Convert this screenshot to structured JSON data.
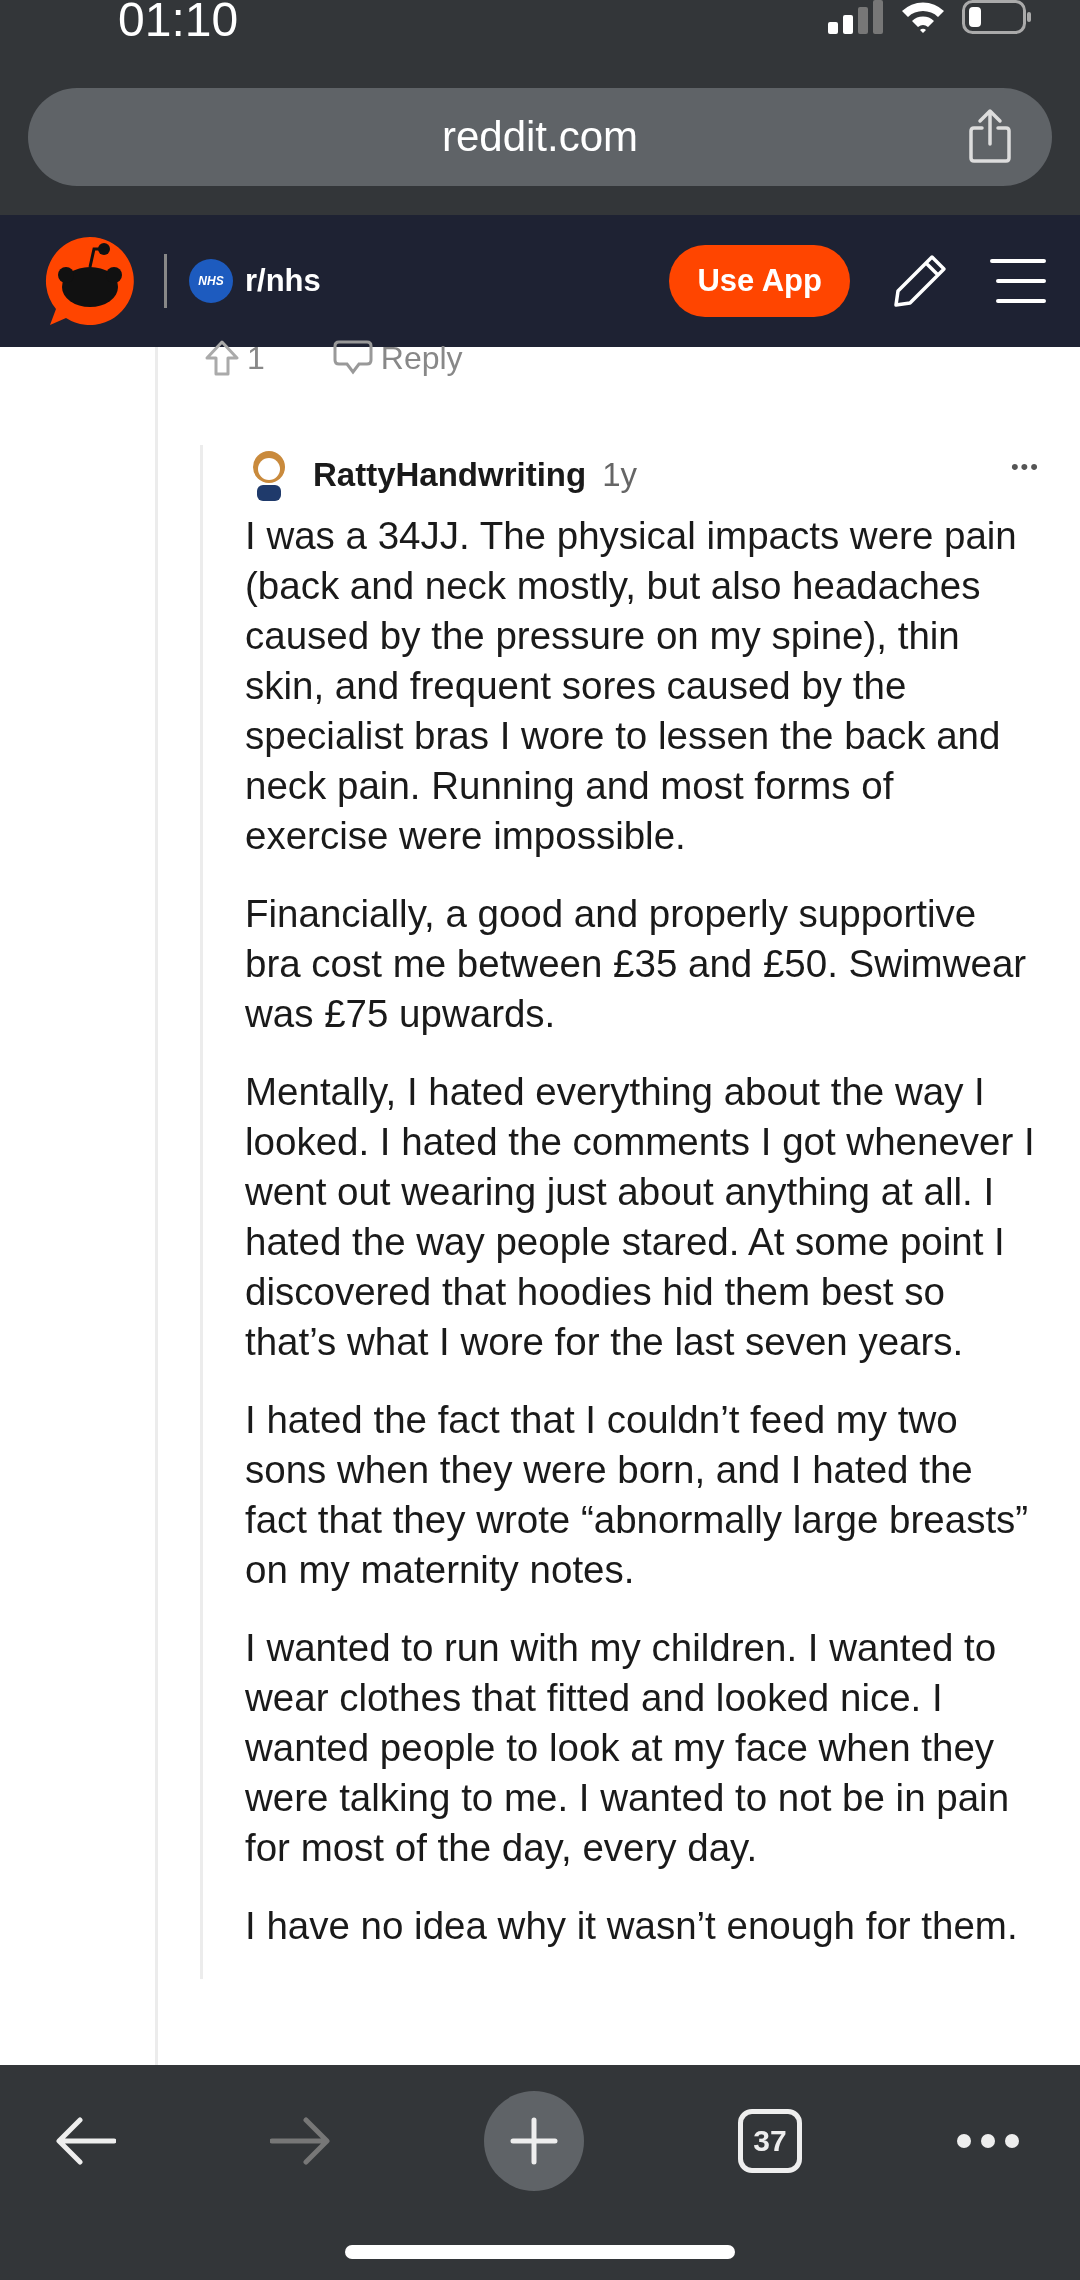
{
  "status_bar": {
    "time": "01:10"
  },
  "browser": {
    "url": "reddit.com",
    "tab_count": "37"
  },
  "reddit_header": {
    "subreddit": "r/nhs",
    "subreddit_badge": "NHS",
    "use_app_button": "Use App"
  },
  "parent_actions": {
    "votes": "1",
    "reply": "Reply"
  },
  "comment": {
    "author": "RattyHandwriting",
    "age": "1y",
    "more": "•••",
    "paragraphs": [
      "I was a 34JJ. The physical impacts were pain (back and neck mostly, but also headaches caused by the pressure on my spine), thin skin, and frequent sores caused by the specialist bras I wore to lessen the back and neck pain. Running and most forms of exercise were impossible.",
      "Financially, a good and properly supportive bra cost me between £35 and £50. Swimwear was £75 upwards.",
      "Mentally, I hated everything about the way I looked. I hated the comments I got whenever I went out wearing just about anything at all. I hated the way people stared. At some point I discovered that hoodies hid them best so that’s what I wore for the last seven years.",
      "I hated the fact that I couldn’t feed my two sons when they were born, and I hated the fact that they wrote “abnormally large breasts” on my maternity notes.",
      "I wanted to run with my children. I wanted to wear clothes that fitted and looked nice. I wanted people to look at my face when they were talking to me. I wanted to not be in pain for most of the day, every day.",
      "I have no idea why it wasn’t enough for them."
    ]
  },
  "toolbar": {
    "forward_disabled": true
  }
}
